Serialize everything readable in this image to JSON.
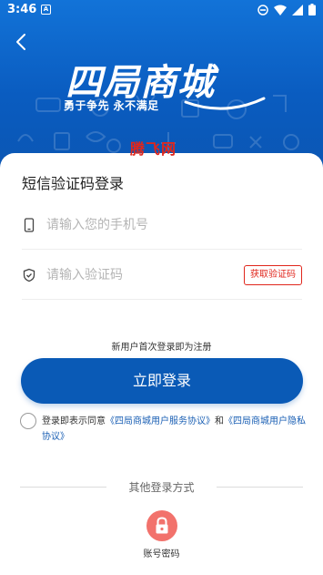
{
  "status_bar": {
    "time": "3:46",
    "notif_icon": "A"
  },
  "header": {
    "logo_text": "四局商城",
    "slogan": "勇于争先  永不满足",
    "watermark": "腾飞网"
  },
  "login": {
    "title": "短信验证码登录",
    "phone_placeholder": "请输入您的手机号",
    "code_placeholder": "请输入验证码",
    "get_code_label": "获取验证码",
    "register_hint": "新用户首次登录即为注册",
    "login_button": "立即登录",
    "agreement_prefix": "登录即表示同意",
    "service_agreement": "《四局商城用户服务协议》",
    "and": "和",
    "privacy_agreement": "《四局商城用户隐私协议》"
  },
  "other_login": {
    "label": "其他登录方式",
    "password_option": "账号密码"
  },
  "colors": {
    "brand_blue": "#0a5ab6",
    "accent_red": "#e0261c",
    "password_icon_bg": "#f2726c"
  }
}
